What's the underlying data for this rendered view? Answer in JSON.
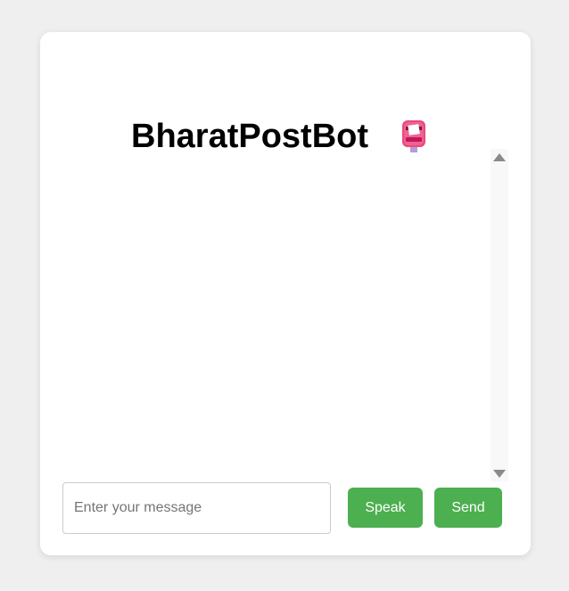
{
  "app": {
    "title": "BharatPostBot",
    "title_icon": "postbox-icon"
  },
  "chat": {
    "messages": []
  },
  "input": {
    "value": "",
    "placeholder": "Enter your message"
  },
  "buttons": {
    "speak_label": "Speak",
    "send_label": "Send"
  },
  "colors": {
    "page_background": "#efefef",
    "card_background": "#ffffff",
    "button_green": "#4caf50",
    "button_text": "#ffffff"
  }
}
